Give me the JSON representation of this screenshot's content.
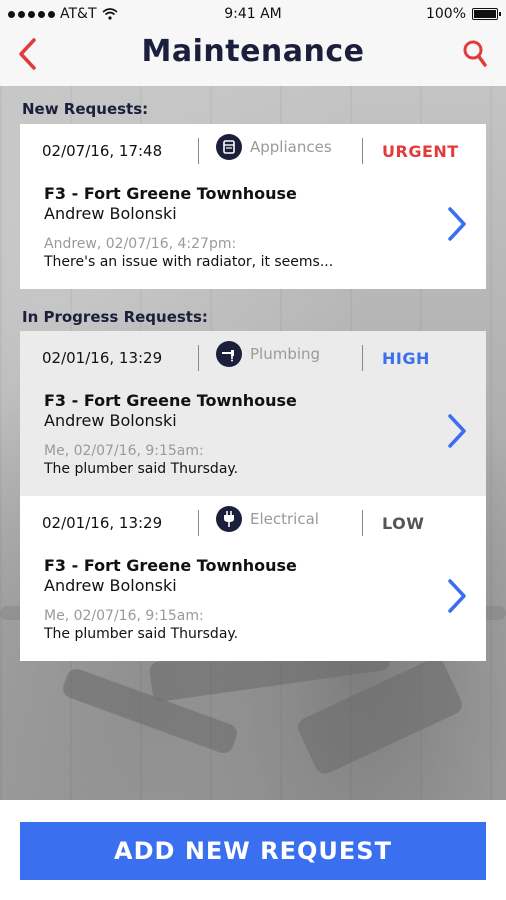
{
  "status_bar": {
    "carrier": "AT&T",
    "time": "9:41 AM",
    "battery": "100%"
  },
  "header": {
    "title": "Maintenance"
  },
  "sections": {
    "new": "New Requests:",
    "in_progress": "In Progress Requests:"
  },
  "requests": [
    {
      "date": "02/07/16, 17:48",
      "category": "Appliances",
      "category_icon": "appliance-icon",
      "priority": "URGENT",
      "priority_color": "#e23b3b",
      "property": "F3 - Fort Greene Townhouse",
      "tenant": "Andrew Bolonski",
      "meta": "Andrew, 02/07/16, 4:27pm:",
      "message": "There's an issue with radiator, it seems..."
    },
    {
      "date": "02/01/16, 13:29",
      "category": "Plumbing",
      "category_icon": "plumbing-icon",
      "priority": "HIGH",
      "priority_color": "#3a6ff0",
      "property": "F3 - Fort Greene Townhouse",
      "tenant": "Andrew Bolonski",
      "meta": "Me, 02/07/16, 9:15am:",
      "message": "The plumber said Thursday."
    },
    {
      "date": "02/01/16, 13:29",
      "category": "Electrical",
      "category_icon": "electrical-plug-icon",
      "priority": "LOW",
      "priority_color": "#555555",
      "property": "F3 - Fort Greene Townhouse",
      "tenant": "Andrew Bolonski",
      "meta": "Me, 02/07/16, 9:15am:",
      "message": "The plumber said Thursday."
    }
  ],
  "actions": {
    "add_request": "ADD NEW REQUEST"
  },
  "colors": {
    "accent": "#3a6ff0",
    "title": "#1b1f3b",
    "nav_icons": "#e23b3b"
  }
}
